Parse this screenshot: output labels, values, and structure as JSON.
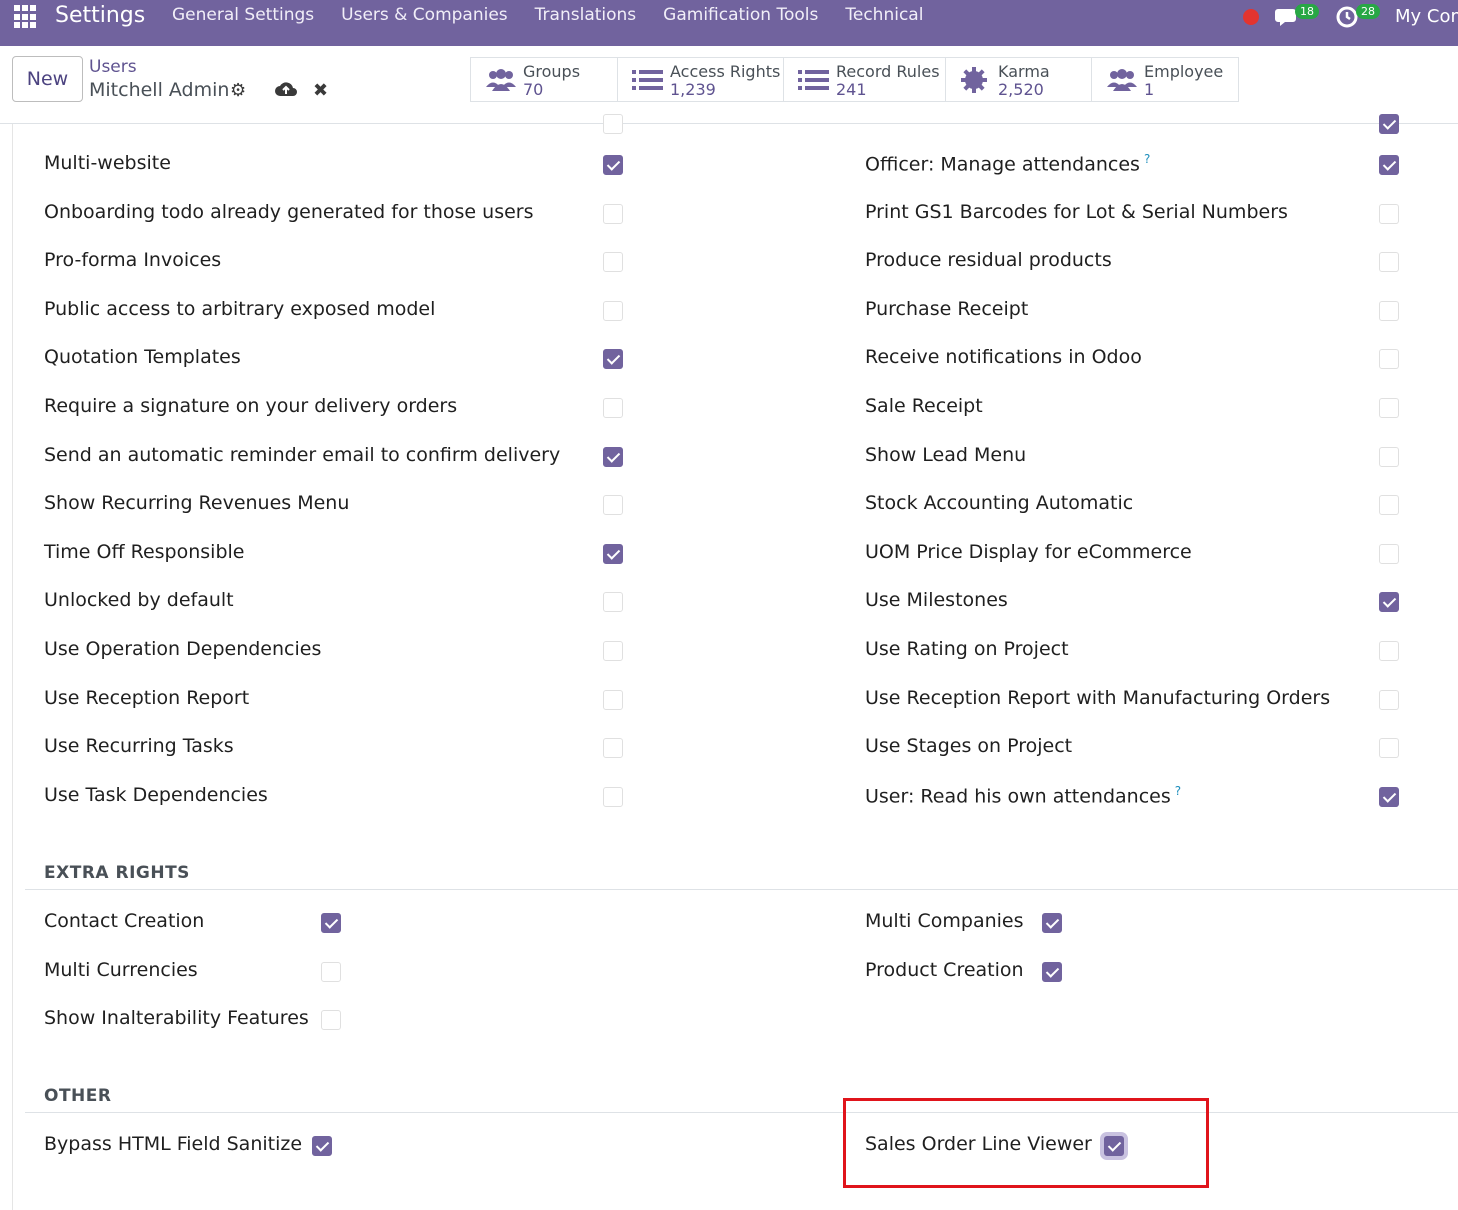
{
  "navbar": {
    "brand": "Settings",
    "menu": [
      "General Settings",
      "Users & Companies",
      "Translations",
      "Gamification Tools",
      "Technical"
    ],
    "messages_count": "18",
    "activities_count": "28",
    "company": "My Com",
    "colors": {
      "primary": "#71639e",
      "badge": "#28a745",
      "status": "#e3342f"
    }
  },
  "control": {
    "new_label": "New",
    "breadcrumb_parent": "Users",
    "breadcrumb_current": "Mitchell Admin",
    "stats": [
      {
        "label": "Groups",
        "value": "70",
        "icon": "users-icon"
      },
      {
        "label": "Access Rights",
        "value": "1,239",
        "icon": "list-icon"
      },
      {
        "label": "Record Rules",
        "value": "241",
        "icon": "list-icon"
      },
      {
        "label": "Karma",
        "value": "2,520",
        "icon": "badge-icon"
      },
      {
        "label": "Employee",
        "value": "1",
        "icon": "users-icon"
      }
    ]
  },
  "left_list": [
    {
      "label": "Multi-website",
      "checked": true
    },
    {
      "label": "Onboarding todo already generated for those users",
      "checked": false
    },
    {
      "label": "Pro-forma Invoices",
      "checked": false
    },
    {
      "label": "Public access to arbitrary exposed model",
      "checked": false
    },
    {
      "label": "Quotation Templates",
      "checked": true
    },
    {
      "label": "Require a signature on your delivery orders",
      "checked": false
    },
    {
      "label": "Send an automatic reminder email to confirm delivery",
      "checked": true
    },
    {
      "label": "Show Recurring Revenues Menu",
      "checked": false
    },
    {
      "label": "Time Off Responsible",
      "checked": true
    },
    {
      "label": "Unlocked by default",
      "checked": false
    },
    {
      "label": "Use Operation Dependencies",
      "checked": false
    },
    {
      "label": "Use Reception Report",
      "checked": false
    },
    {
      "label": "Use Recurring Tasks",
      "checked": false
    },
    {
      "label": "Use Task Dependencies",
      "checked": false
    }
  ],
  "right_list": [
    {
      "label": "Officer: Manage attendances",
      "checked": true,
      "help": "?"
    },
    {
      "label": "Print GS1 Barcodes for Lot & Serial Numbers",
      "checked": false
    },
    {
      "label": "Produce residual products",
      "checked": false
    },
    {
      "label": "Purchase Receipt",
      "checked": false
    },
    {
      "label": "Receive notifications in Odoo",
      "checked": false
    },
    {
      "label": "Sale Receipt",
      "checked": false
    },
    {
      "label": "Show Lead Menu",
      "checked": false
    },
    {
      "label": "Stock Accounting Automatic",
      "checked": false
    },
    {
      "label": "UOM Price Display for eCommerce",
      "checked": false
    },
    {
      "label": "Use Milestones",
      "checked": true
    },
    {
      "label": "Use Rating on Project",
      "checked": false
    },
    {
      "label": "Use Reception Report with Manufacturing Orders",
      "checked": false
    },
    {
      "label": "Use Stages on Project",
      "checked": false
    },
    {
      "label": "User: Read his own attendances",
      "checked": true,
      "help": "?"
    }
  ],
  "extra_rights": {
    "title": "EXTRA RIGHTS",
    "left": [
      {
        "label": "Contact Creation",
        "checked": true
      },
      {
        "label": "Multi Currencies",
        "checked": false
      },
      {
        "label": "Show Inalterability Features",
        "checked": false
      }
    ],
    "right": [
      {
        "label": "Multi Companies",
        "checked": true
      },
      {
        "label": "Product Creation",
        "checked": true
      }
    ]
  },
  "other": {
    "title": "OTHER",
    "left": [
      {
        "label": "Bypass HTML Field Sanitize",
        "checked": true
      }
    ],
    "right": [
      {
        "label": "Sales Order Line Viewer",
        "checked": true
      }
    ]
  }
}
